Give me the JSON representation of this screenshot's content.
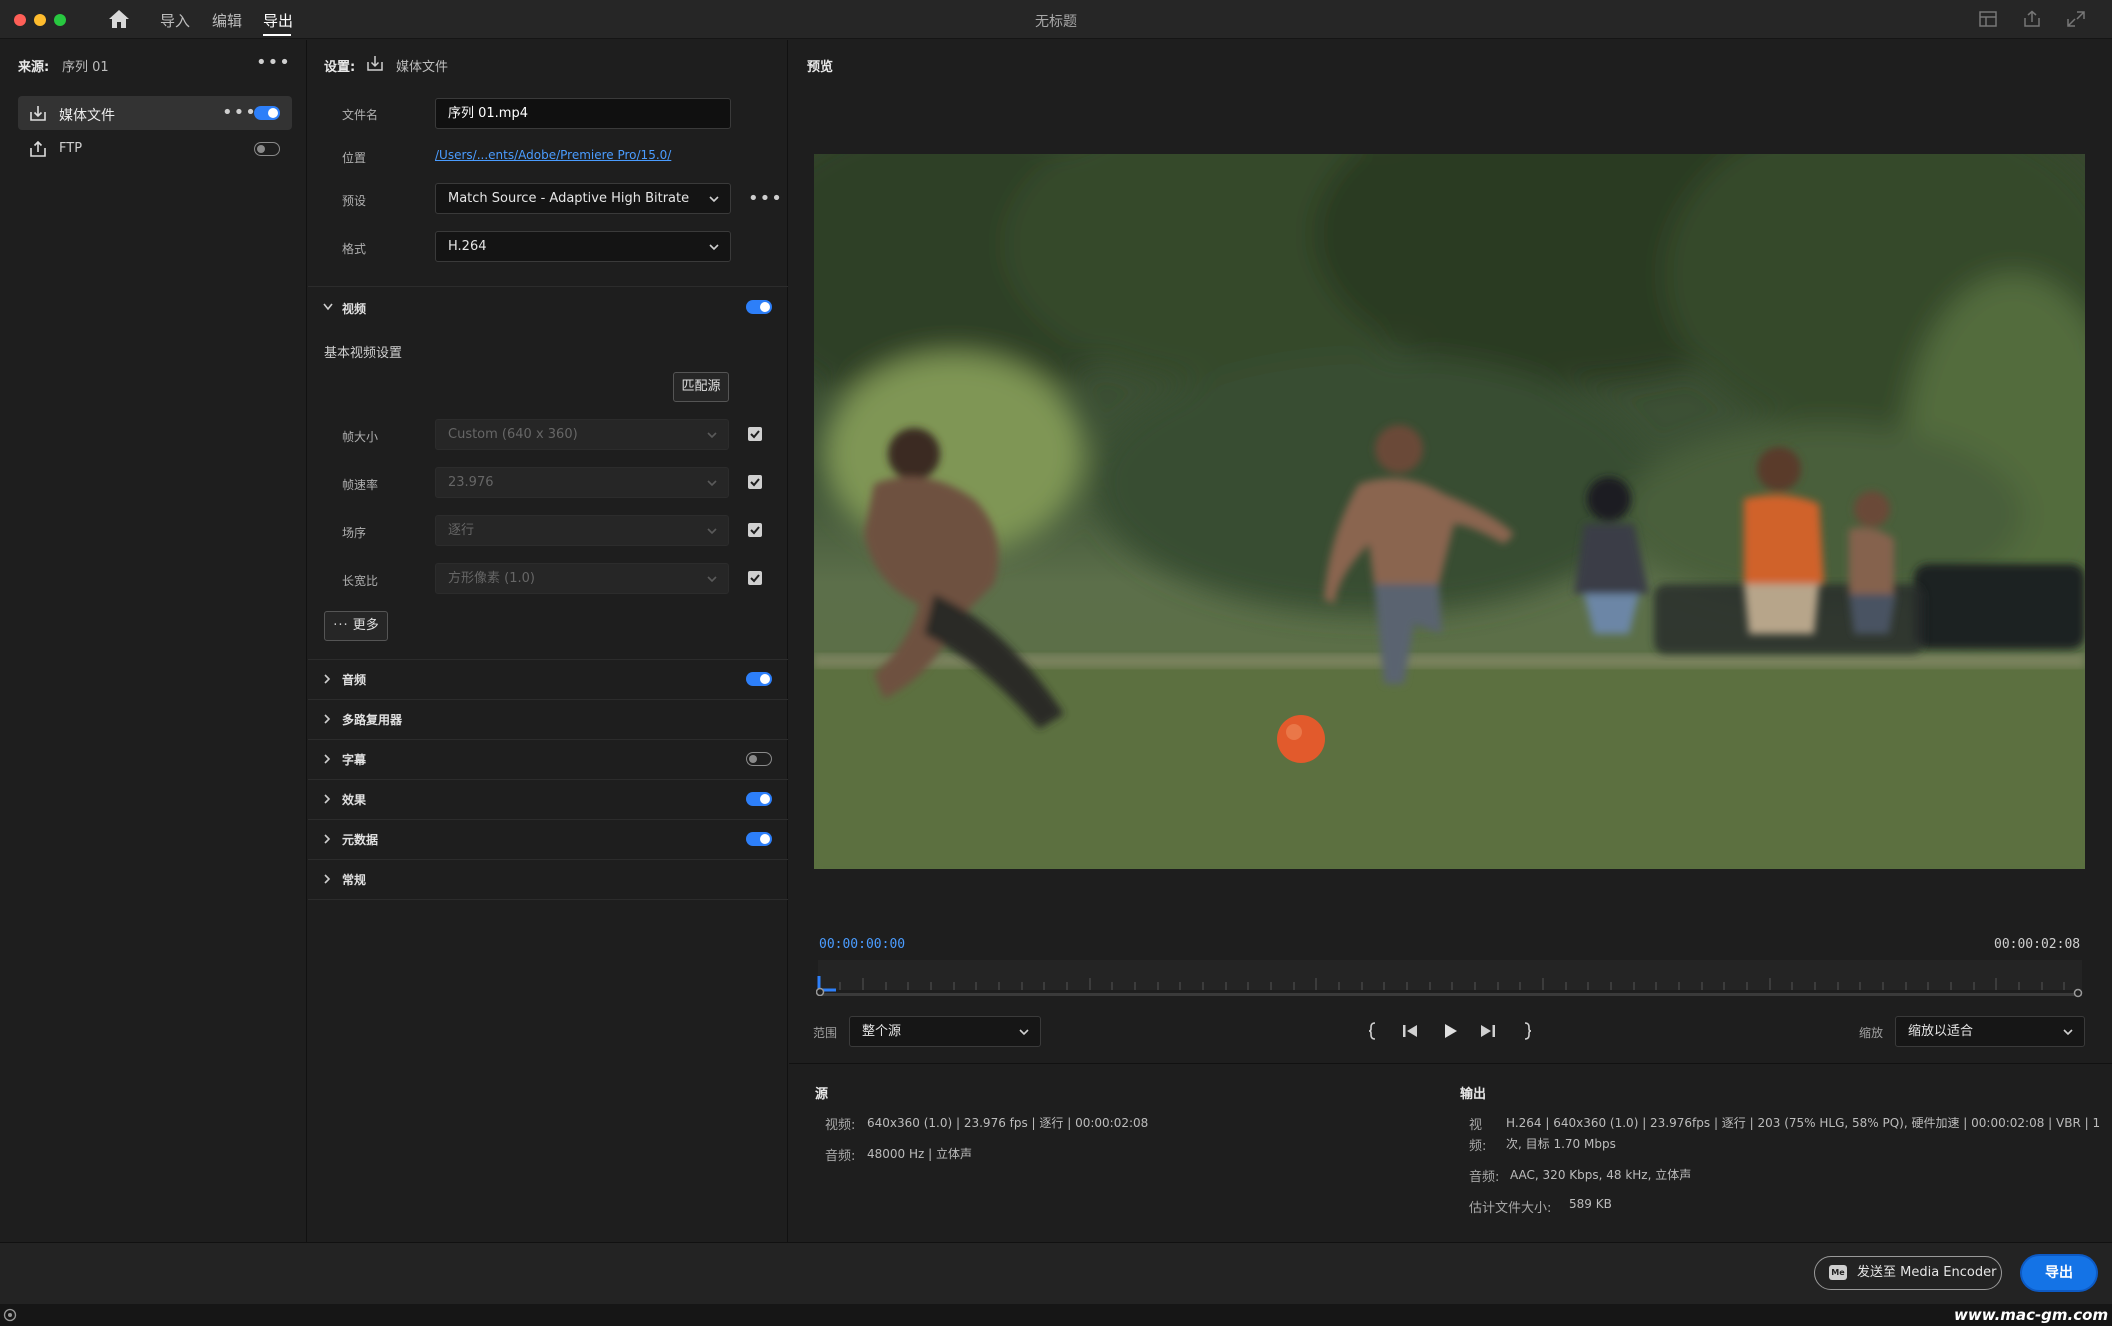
{
  "titlebar": {
    "title": "无标题",
    "tabs": [
      {
        "label": "导入",
        "active": false
      },
      {
        "label": "编辑",
        "active": false
      },
      {
        "label": "导出",
        "active": true
      }
    ]
  },
  "source_panel": {
    "label": "来源:",
    "sequence": "序列 01",
    "items": [
      {
        "label": "媒体文件",
        "icon": "export-file-icon",
        "enabled": true,
        "selected": true
      },
      {
        "label": "FTP",
        "icon": "upload-icon",
        "enabled": false,
        "selected": false
      }
    ]
  },
  "settings": {
    "label": "设置:",
    "target": "媒体文件",
    "filename_label": "文件名",
    "filename_value": "序列 01.mp4",
    "location_label": "位置",
    "location_value": "/Users/...ents/Adobe/Premiere Pro/15.0/",
    "preset_label": "预设",
    "preset_value": "Match Source - Adaptive High Bitrate",
    "format_label": "格式",
    "format_value": "H.264",
    "video": {
      "title": "视频",
      "enabled": true,
      "basic_label": "基本视频设置",
      "match_source_label": "匹配源",
      "rows": [
        {
          "label": "帧大小",
          "value": "Custom (640 x 360)",
          "checked": true
        },
        {
          "label": "帧速率",
          "value": "23.976",
          "checked": true
        },
        {
          "label": "场序",
          "value": "逐行",
          "checked": true
        },
        {
          "label": "长宽比",
          "value": "方形像素 (1.0)",
          "checked": true
        }
      ],
      "more_label": "更多"
    },
    "sections": [
      {
        "title": "音频",
        "toggle": "on"
      },
      {
        "title": "多路复用器",
        "toggle": "none"
      },
      {
        "title": "字幕",
        "toggle": "off"
      },
      {
        "title": "效果",
        "toggle": "on"
      },
      {
        "title": "元数据",
        "toggle": "on"
      },
      {
        "title": "常规",
        "toggle": "none"
      }
    ]
  },
  "preview": {
    "label": "预览",
    "timecode_start": "00:00:00:00",
    "timecode_end": "00:00:02:08",
    "range_label": "范围",
    "range_value": "整个源",
    "zoom_label": "缩放",
    "zoom_value": "缩放以适合"
  },
  "info": {
    "source_title": "源",
    "source_video_label": "视频:",
    "source_video_value": "640x360 (1.0)  |  23.976 fps  |  逐行  |  00:00:02:08",
    "source_audio_label": "音频:",
    "source_audio_value": "48000 Hz  |  立体声",
    "output_title": "输出",
    "output_video_label_1": "视",
    "output_video_label_2": "频:",
    "output_video_value_1": "H.264  |  640x360 (1.0)  |  23.976fps  |  逐行  |  203 (75% HLG, 58% PQ), 硬件加速  |  00:00:02:08  |  VBR  |  1",
    "output_video_value_2": "次, 目标 1.70 Mbps",
    "output_audio_label": "音频:",
    "output_audio_value": "AAC, 320 Kbps, 48 kHz, 立体声",
    "filesize_label": "估计文件大小:",
    "filesize_value": "589 KB"
  },
  "footer": {
    "media_encoder_badge": "Me",
    "media_encoder_label": "发送至 Media Encoder",
    "export_label": "导出"
  },
  "watermark": "www.mac-gm.com",
  "colors": {
    "accent": "#2d7ff9",
    "export_button": "#1473e6",
    "link": "#4a9cff",
    "timecode": "#4a9cff"
  }
}
